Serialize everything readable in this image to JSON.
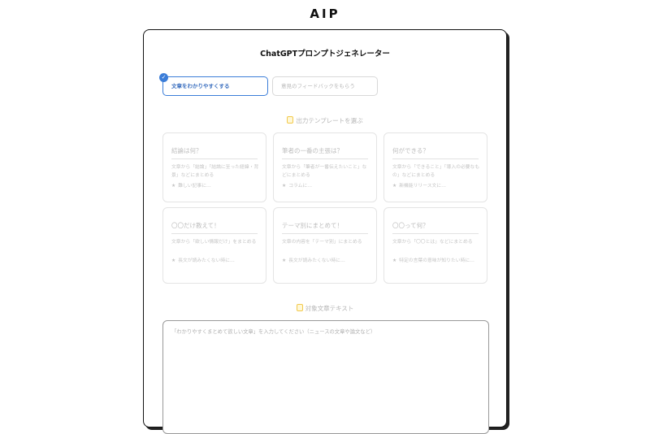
{
  "header": {
    "logo": "AIP"
  },
  "card": {
    "title": "ChatGPTプロンプトジェネレーター"
  },
  "tabs": [
    {
      "label": "文章をわかりやすくする",
      "active": true
    },
    {
      "label": "意見のフィードバックをもらう",
      "active": false
    }
  ],
  "templates": {
    "label": "出力テンプレートを選ぶ",
    "items": [
      {
        "title": "結論は何？",
        "desc": "文章から「結論」「結論に至った経緯・背景」などにまとめる",
        "example": "難しい記事に…"
      },
      {
        "title": "筆者の一番の主張は？",
        "desc": "文章から「筆者が一番伝えたいこと」などにまとめる",
        "example": "コラムに…"
      },
      {
        "title": "何ができる？",
        "desc": "文章から「できること」「導入の必要なもの」などにまとめる",
        "example": "新機能リリース文に…"
      },
      {
        "title": "〇〇だけ教えて！",
        "desc": "文章から「欲しい情報だけ」をまとめる",
        "example": "長文が読みたくない時に…"
      },
      {
        "title": "テーマ別にまとめて！",
        "desc": "文章の内容を「テーマ別」にまとめる",
        "example": "長文が読みたくない時に…"
      },
      {
        "title": "〇〇って何？",
        "desc": "文章から「〇〇とは」などにまとめる",
        "example": "特定の言葉の意味が知りたい時に…"
      }
    ]
  },
  "input": {
    "label": "対象文章テキスト",
    "placeholder": "「わかりやすくまとめて欲しい文章」を入力してください（ニュースの文章や論文など）"
  },
  "colors": {
    "accent": "#3b7dd8",
    "icon_yellow": "#f2c94c"
  },
  "icons": {
    "check": "check-icon",
    "doc": "document-icon",
    "star": "star-icon"
  }
}
